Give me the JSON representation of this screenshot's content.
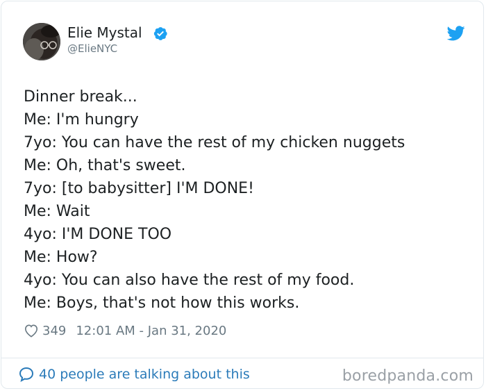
{
  "author": {
    "display_name": "Elie Mystal",
    "handle": "@ElieNYC",
    "verified": true
  },
  "tweet": {
    "lines": [
      "Dinner break...",
      "Me: I'm hungry",
      "7yo: You can have the rest of my chicken nuggets",
      "Me: Oh, that's sweet.",
      "7yo: [to babysitter] I'M DONE!",
      "Me: Wait",
      "4yo: I'M DONE TOO",
      "Me: How?",
      "4yo: You can also have the rest of my food.",
      "Me: Boys, that's not how this works."
    ],
    "likes": "349",
    "timestamp": "12:01 AM - Jan 31, 2020"
  },
  "footer": {
    "talking_label": "40 people are talking about this"
  },
  "watermark": "boredpanda.com",
  "colors": {
    "twitter_blue": "#1da1f2",
    "link_blue": "#2b7bb9",
    "text": "#1c2022",
    "muted": "#697882"
  },
  "icons": {
    "verified": "verified-badge-icon",
    "bird": "twitter-bird-icon",
    "like": "heart-icon",
    "replies": "speech-bubble-icon"
  }
}
